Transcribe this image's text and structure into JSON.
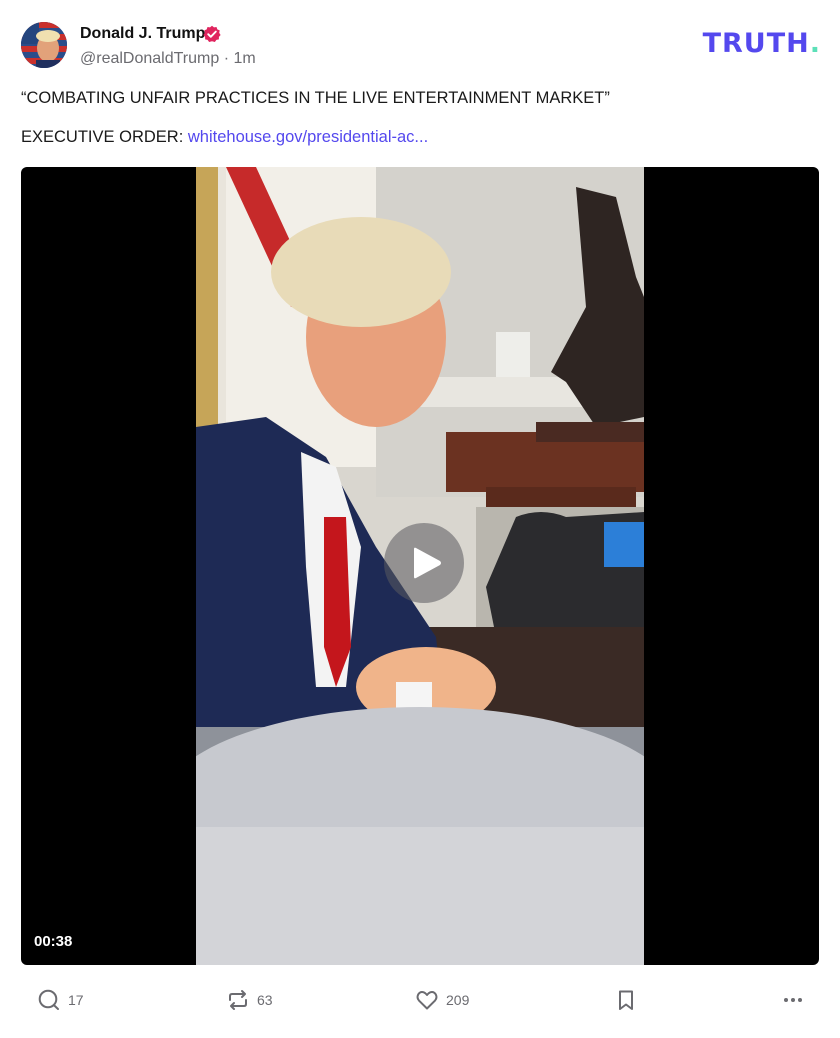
{
  "author": {
    "name": "Donald J. Trump",
    "handle": "@realDonaldTrump",
    "separator": "·",
    "time": "1m",
    "verified_color": "#e0245e"
  },
  "brand": {
    "logo_text": "TRUTH",
    "logo_dot": ".",
    "accent": "#5448ee",
    "dot_color": "#5ce0b8"
  },
  "post": {
    "headline": "“COMBATING UNFAIR PRACTICES IN THE LIVE ENTERTAINMENT MARKET”",
    "order_label": "EXECUTIVE ORDER:",
    "order_link": "whitehouse.gov/presidential-ac..."
  },
  "video": {
    "duration": "00:38",
    "play_icon": "play-icon"
  },
  "actions": {
    "replies": "17",
    "retruths": "63",
    "likes": "209",
    "icons": [
      "reply-icon",
      "retruth-icon",
      "heart-icon",
      "bookmark-icon",
      "more-icon"
    ]
  }
}
